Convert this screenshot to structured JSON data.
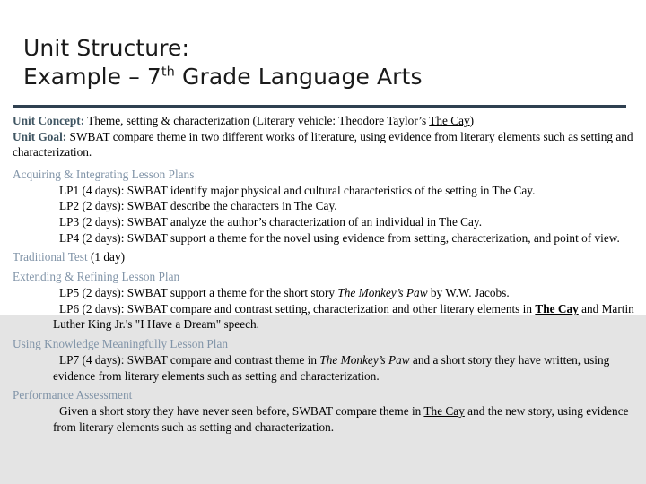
{
  "slide": {
    "title_line_1": "Unit Structure:",
    "title_line_2_before": "Example – 7",
    "title_line_2_sup": "th",
    "title_line_2_after": " Grade Language Arts",
    "divider_color": "#2f4050",
    "band_color": "#e4e4e4",
    "heading_color": "#8194a8",
    "lead_color": "#3f5562"
  },
  "overview": {
    "concept_label": "Unit Concept:",
    "concept_text_a": " Theme, setting & characterization (Literary vehicle:  Theodore Taylor’s ",
    "concept_work": "The Cay",
    "concept_text_b": ")",
    "goal_label": "Unit Goal:",
    "goal_text": " SWBAT compare theme in two different works of literature, using evidence from literary elements such as setting and characterization."
  },
  "sections": {
    "acquiring": {
      "heading": "Acquiring & Integrating Lesson Plans",
      "lessons": [
        "LP1 (4 days):  SWBAT identify major physical and cultural characteristics of the setting in The Cay.",
        "LP2 (2 days):  SWBAT describe the characters in The Cay.",
        "LP3 (2 days):  SWBAT analyze the author’s characterization of an individual in The Cay.",
        "LP4 (2 days):  SWBAT support a theme for the novel using evidence from setting, characterization, and point of view."
      ]
    },
    "traditional_test": {
      "heading": "Traditional Test",
      "duration": " (1 day)"
    },
    "extending": {
      "heading": "Extending & Refining Lesson Plan",
      "lp5_a": "LP5 (2 days):  SWBAT support a theme for the short story ",
      "lp5_work": "The Monkey’s Paw",
      "lp5_b": " by W.W. Jacobs.",
      "lp6_a": "LP6 (2 days):  SWBAT compare and contrast setting, characterization and other literary elements in ",
      "lp6_work": "The Cay",
      "lp6_b": " and Martin Luther King Jr.'s \"I Have a Dream\" speech."
    },
    "using_knowledge": {
      "heading": "Using Knowledge Meaningfully Lesson Plan",
      "lp7_a": "LP7 (4 days):  SWBAT compare and contrast theme in ",
      "lp7_work": "The Monkey’s Paw",
      "lp7_b": " and a short story they have written, using evidence from literary elements such as setting and characterization."
    },
    "performance_assessment": {
      "heading": "Performance Assessment",
      "body_a": "Given a short story they have never seen before, SWBAT compare theme in ",
      "body_work": "The Cay",
      "body_b": " and the new story, using evidence from literary elements such as setting and characterization."
    }
  }
}
